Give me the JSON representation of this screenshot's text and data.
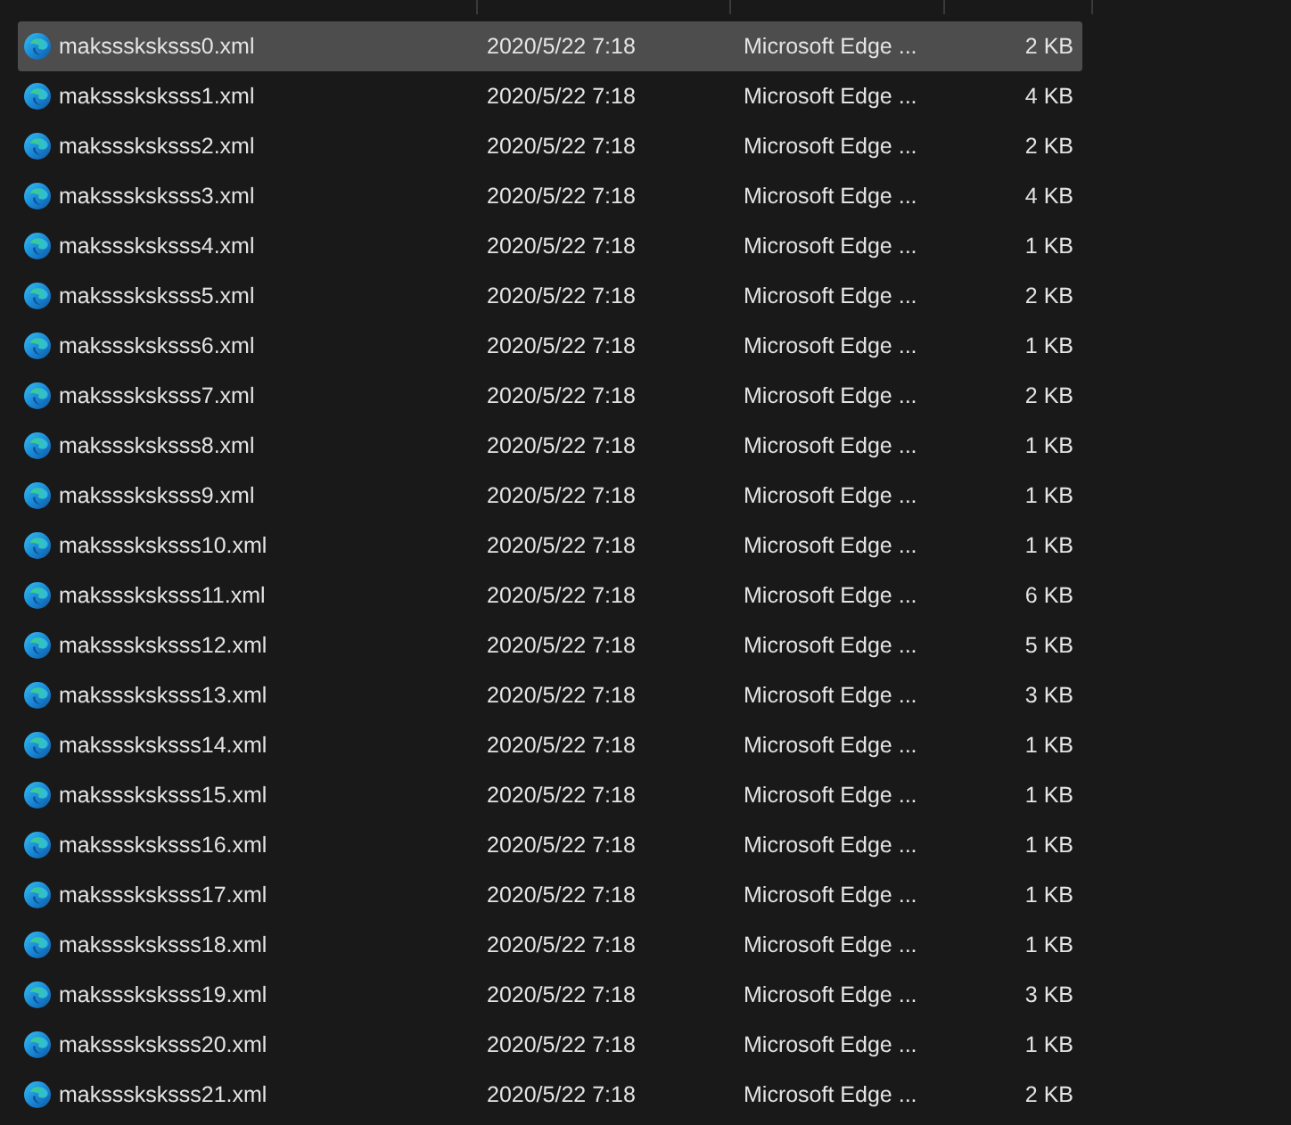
{
  "files": [
    {
      "name": "maksssksksss0.xml",
      "modified": "2020/5/22 7:18",
      "type": "Microsoft Edge ...",
      "size": "2 KB",
      "selected": true
    },
    {
      "name": "maksssksksss1.xml",
      "modified": "2020/5/22 7:18",
      "type": "Microsoft Edge ...",
      "size": "4 KB",
      "selected": false
    },
    {
      "name": "maksssksksss2.xml",
      "modified": "2020/5/22 7:18",
      "type": "Microsoft Edge ...",
      "size": "2 KB",
      "selected": false
    },
    {
      "name": "maksssksksss3.xml",
      "modified": "2020/5/22 7:18",
      "type": "Microsoft Edge ...",
      "size": "4 KB",
      "selected": false
    },
    {
      "name": "maksssksksss4.xml",
      "modified": "2020/5/22 7:18",
      "type": "Microsoft Edge ...",
      "size": "1 KB",
      "selected": false
    },
    {
      "name": "maksssksksss5.xml",
      "modified": "2020/5/22 7:18",
      "type": "Microsoft Edge ...",
      "size": "2 KB",
      "selected": false
    },
    {
      "name": "maksssksksss6.xml",
      "modified": "2020/5/22 7:18",
      "type": "Microsoft Edge ...",
      "size": "1 KB",
      "selected": false
    },
    {
      "name": "maksssksksss7.xml",
      "modified": "2020/5/22 7:18",
      "type": "Microsoft Edge ...",
      "size": "2 KB",
      "selected": false
    },
    {
      "name": "maksssksksss8.xml",
      "modified": "2020/5/22 7:18",
      "type": "Microsoft Edge ...",
      "size": "1 KB",
      "selected": false
    },
    {
      "name": "maksssksksss9.xml",
      "modified": "2020/5/22 7:18",
      "type": "Microsoft Edge ...",
      "size": "1 KB",
      "selected": false
    },
    {
      "name": "maksssksksss10.xml",
      "modified": "2020/5/22 7:18",
      "type": "Microsoft Edge ...",
      "size": "1 KB",
      "selected": false
    },
    {
      "name": "maksssksksss11.xml",
      "modified": "2020/5/22 7:18",
      "type": "Microsoft Edge ...",
      "size": "6 KB",
      "selected": false
    },
    {
      "name": "maksssksksss12.xml",
      "modified": "2020/5/22 7:18",
      "type": "Microsoft Edge ...",
      "size": "5 KB",
      "selected": false
    },
    {
      "name": "maksssksksss13.xml",
      "modified": "2020/5/22 7:18",
      "type": "Microsoft Edge ...",
      "size": "3 KB",
      "selected": false
    },
    {
      "name": "maksssksksss14.xml",
      "modified": "2020/5/22 7:18",
      "type": "Microsoft Edge ...",
      "size": "1 KB",
      "selected": false
    },
    {
      "name": "maksssksksss15.xml",
      "modified": "2020/5/22 7:18",
      "type": "Microsoft Edge ...",
      "size": "1 KB",
      "selected": false
    },
    {
      "name": "maksssksksss16.xml",
      "modified": "2020/5/22 7:18",
      "type": "Microsoft Edge ...",
      "size": "1 KB",
      "selected": false
    },
    {
      "name": "maksssksksss17.xml",
      "modified": "2020/5/22 7:18",
      "type": "Microsoft Edge ...",
      "size": "1 KB",
      "selected": false
    },
    {
      "name": "maksssksksss18.xml",
      "modified": "2020/5/22 7:18",
      "type": "Microsoft Edge ...",
      "size": "1 KB",
      "selected": false
    },
    {
      "name": "maksssksksss19.xml",
      "modified": "2020/5/22 7:18",
      "type": "Microsoft Edge ...",
      "size": "3 KB",
      "selected": false
    },
    {
      "name": "maksssksksss20.xml",
      "modified": "2020/5/22 7:18",
      "type": "Microsoft Edge ...",
      "size": "1 KB",
      "selected": false
    },
    {
      "name": "maksssksksss21.xml",
      "modified": "2020/5/22 7:18",
      "type": "Microsoft Edge ...",
      "size": "2 KB",
      "selected": false
    }
  ]
}
